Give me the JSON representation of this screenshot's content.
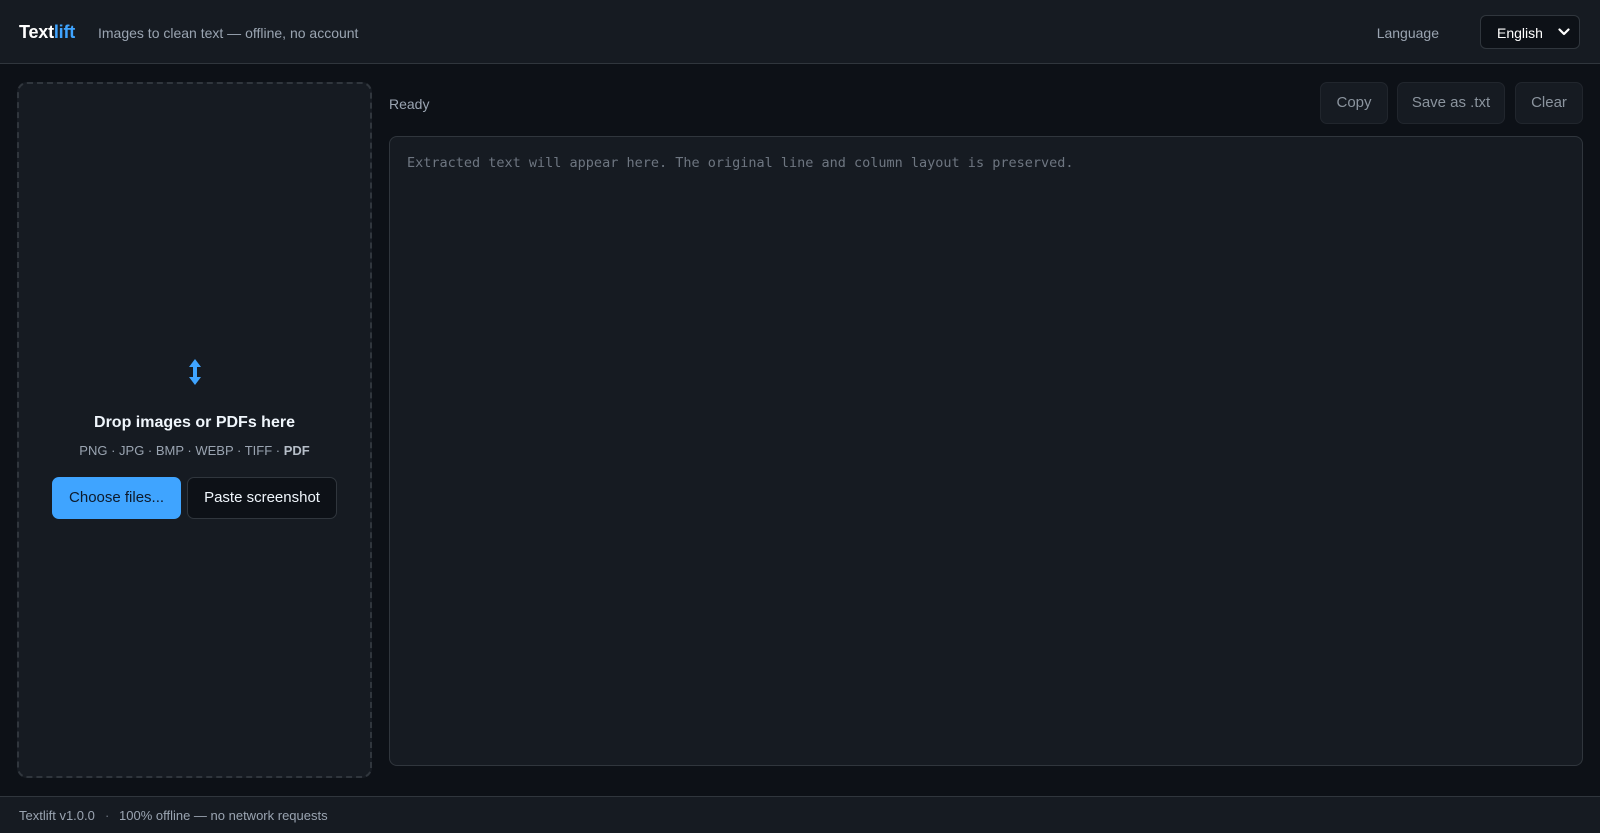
{
  "header": {
    "brand_main": "Text",
    "brand_accent": "lift",
    "tagline": "Images to clean text — offline, no account",
    "language_label": "Language",
    "language_value": "English"
  },
  "dropzone": {
    "icon": "up-down-arrow-icon",
    "title": "Drop images or PDFs here",
    "formats": "PNG · JPG · BMP · WEBP · TIFF · ",
    "formats_bold": "PDF",
    "choose_label": "Choose files...",
    "paste_label": "Paste screenshot"
  },
  "toolbar": {
    "status": "Ready",
    "copy_label": "Copy",
    "save_label": "Save as .txt",
    "clear_label": "Clear"
  },
  "output": {
    "placeholder": "Extracted text will appear here. The original line and column layout is preserved."
  },
  "footer": {
    "version": "Textlift v1.0.0",
    "separator": "·",
    "offline": "100% offline — no network requests"
  },
  "colors": {
    "accent": "#3fa4ff",
    "background": "#0d1117",
    "panel": "#161b22",
    "border": "#30363d"
  }
}
